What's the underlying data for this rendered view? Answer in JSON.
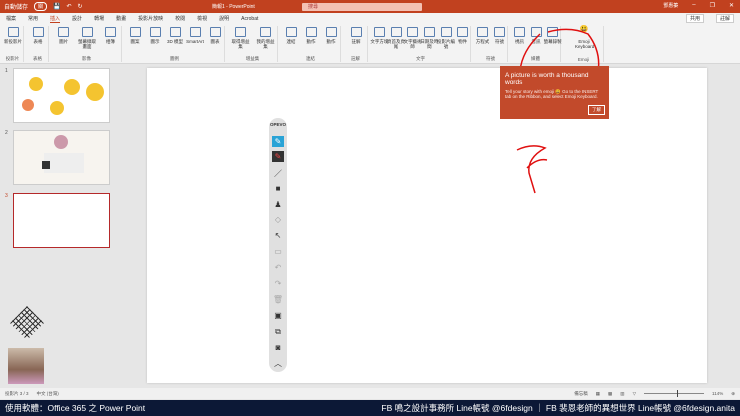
{
  "titlebar": {
    "autosave": "自動儲存",
    "autosave_state": "關",
    "title": "簡報1 - PowerPoint",
    "search": "搜尋",
    "user": "鄧惠蓁"
  },
  "tabs": [
    "檔案",
    "常用",
    "插入",
    "設計",
    "轉場",
    "動畫",
    "投影片放映",
    "校閱",
    "檢視",
    "說明",
    "Acrobat"
  ],
  "active_tab": "插入",
  "share": "共用",
  "comments": "註解",
  "ribbon": {
    "groups": [
      {
        "label": "投影片",
        "buttons": [
          "新投影片"
        ]
      },
      {
        "label": "表格",
        "buttons": [
          "表格"
        ]
      },
      {
        "label": "影像",
        "buttons": [
          "圖片",
          "螢幕擷取畫面",
          "相簿"
        ]
      },
      {
        "label": "圖例",
        "buttons": [
          "圖案",
          "圖示",
          "3D 模型",
          "SmartArt",
          "圖表"
        ]
      },
      {
        "label": "增益集",
        "buttons": [
          "取得增益集",
          "我的增益集"
        ]
      },
      {
        "label": "連結",
        "buttons": [
          "連結",
          "動作",
          "動作"
        ]
      },
      {
        "label": "註解",
        "buttons": [
          "註解"
        ]
      },
      {
        "label": "文字",
        "buttons": [
          "文字方塊",
          "頁首及頁尾",
          "文字藝術師",
          "日期及時間",
          "投影片編號",
          "物件"
        ]
      },
      {
        "label": "符號",
        "buttons": [
          "方程式",
          "符號"
        ]
      },
      {
        "label": "媒體",
        "buttons": [
          "視訊",
          "音訊",
          "螢幕錄製"
        ]
      },
      {
        "label": "Emoji",
        "buttons": [
          "Emoji Keyboard"
        ]
      }
    ]
  },
  "slides": [
    "1",
    "2",
    "3"
  ],
  "tooltip": {
    "title": "A picture is worth a thousand words",
    "body": "Tell your story with emoji 😀 Go to the INSERT tab on the Ribbon, and select Emoji Keyboard.",
    "button": "了解"
  },
  "opevo": {
    "label": "OPEVO"
  },
  "status": {
    "slide": "投影片 3 / 3",
    "lang": "中文 (台灣)",
    "notes": "備忘稿",
    "zoom": "114%"
  },
  "caption": {
    "left": "使用軟體：Office 365 之 Power Point",
    "right": "FB 鳴之設計事務所 Line帳號 @6fdesign ｜ FB 裴恩老師的異想世界 Line帳號 @6fdesign.anita"
  },
  "colors": {
    "accent": "#c1411f",
    "caption_bg": "#0c1836",
    "annotation": "#e01010"
  }
}
